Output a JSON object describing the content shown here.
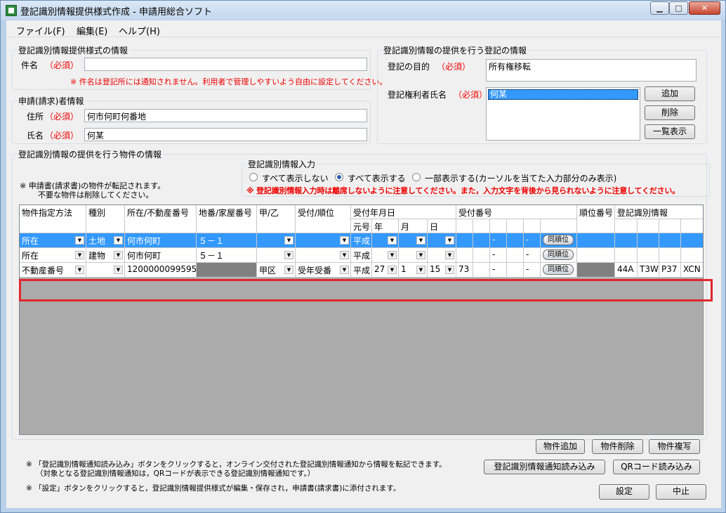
{
  "window": {
    "title": "登記識別情報提供様式作成 - 申請用総合ソフト",
    "min": "▁",
    "max": "□",
    "close": "✕"
  },
  "menu": [
    "ファイル(F)",
    "編集(E)",
    "ヘルプ(H)"
  ],
  "form_info": {
    "label": "登記識別情報提供様式の情報",
    "case_label": "件名",
    "required": "（必須）",
    "case_value": "",
    "case_note": "※ 件名は登記所には通知されません。利用者で管理しやすいよう自由に設定してください。"
  },
  "applicant": {
    "label": "申請(請求)者情報",
    "address_label": "住所",
    "address_value": "何市何町何番地",
    "name_label": "氏名",
    "name_value": "何某",
    "required": "（必須）"
  },
  "registration": {
    "label": "登記識別情報の提供を行う登記の情報",
    "purpose_label": "登記の目的",
    "purpose_value": "所有権移転",
    "holder_label": "登記権利者氏名",
    "holder_items": [
      "何某"
    ],
    "required": "（必須）",
    "add": "追加",
    "delete": "削除",
    "list": "一覧表示"
  },
  "property": {
    "label": "登記識別情報の提供を行う物件の情報",
    "note1": "※ 申請書(請求書)の物件が転記されます。",
    "note2": "不要な物件は削除してください。",
    "input_label": "登記識別情報入力",
    "radios": [
      "すべて表示しない",
      "すべて表示する",
      "一部表示する(カーソルを当てた入力部分のみ表示)"
    ],
    "selected_radio": 1,
    "warning": "※ 登記識別情報入力時は離席しないように注意してください。また，入力文字を背後から見られないように注意してください。"
  },
  "grid": {
    "headers": {
      "method": "物件指定方法",
      "type": "種別",
      "location": "所在/不動産番号",
      "lot": "地番/家屋番号",
      "kou": "甲/乙",
      "recv_order": "受付/順位",
      "recv_date": "受付年月日",
      "era": "元号",
      "year": "年",
      "month": "月",
      "day": "日",
      "recv_no": "受付番号",
      "rank": "順位番号",
      "id_info": "登記識別情報"
    },
    "rows": [
      {
        "method": "所在",
        "type": "土地",
        "location": "何市何町",
        "lot": "５－１",
        "kou": "",
        "recv_order": "",
        "era": "平成",
        "year": "",
        "month": "",
        "day": "",
        "no1": "",
        "no2": "",
        "no3": "-",
        "no4": "",
        "no5": "-",
        "no6": "",
        "same": "同順位",
        "rank": "",
        "id": [
          "",
          "",
          "",
          ""
        ]
      },
      {
        "method": "所在",
        "type": "建物",
        "location": "何市何町",
        "lot": "５－１",
        "kou": "",
        "recv_order": "",
        "era": "平成",
        "year": "",
        "month": "",
        "day": "",
        "no1": "",
        "no2": "",
        "no3": "-",
        "no4": "",
        "no5": "-",
        "no6": "",
        "same": "同順位",
        "rank": "",
        "id": [
          "",
          "",
          "",
          ""
        ]
      },
      {
        "method": "不動産番号",
        "type": "",
        "location": "1200000099595",
        "lot": "",
        "kou": "甲区",
        "recv_order": "受年受番",
        "era": "平成",
        "year": "27",
        "month": "1",
        "day": "15",
        "no1": "73",
        "no2": "",
        "no3": "-",
        "no4": "",
        "no5": "-",
        "no6": "",
        "same": "同順位",
        "rank": "",
        "id": [
          "44A",
          "T3W",
          "P37",
          "XCN"
        ]
      }
    ]
  },
  "buttons": {
    "add_property": "物件追加",
    "delete_property": "物件削除",
    "copy_property": "物件複写",
    "read_notice": "登記識別情報通知読み込み",
    "read_qr": "QRコード読み込み",
    "set": "設定",
    "cancel": "中止"
  },
  "notes": {
    "n1": "※ 「登記識別情報通知読み込み」ボタンをクリックすると，オンライン交付された登記識別情報通知から情報を転記できます。",
    "n2": "（対象となる登記識別情報通知は，QRコードが表示できる登記識別情報通知です。）",
    "n3": "※ 「設定」ボタンをクリックすると，登記識別情報提供様式が編集・保存され，申請書(請求書)に添付されます。"
  },
  "colors": {
    "selected_row": "#3399ff",
    "highlight": "#e0262d",
    "required": "#e00000"
  }
}
